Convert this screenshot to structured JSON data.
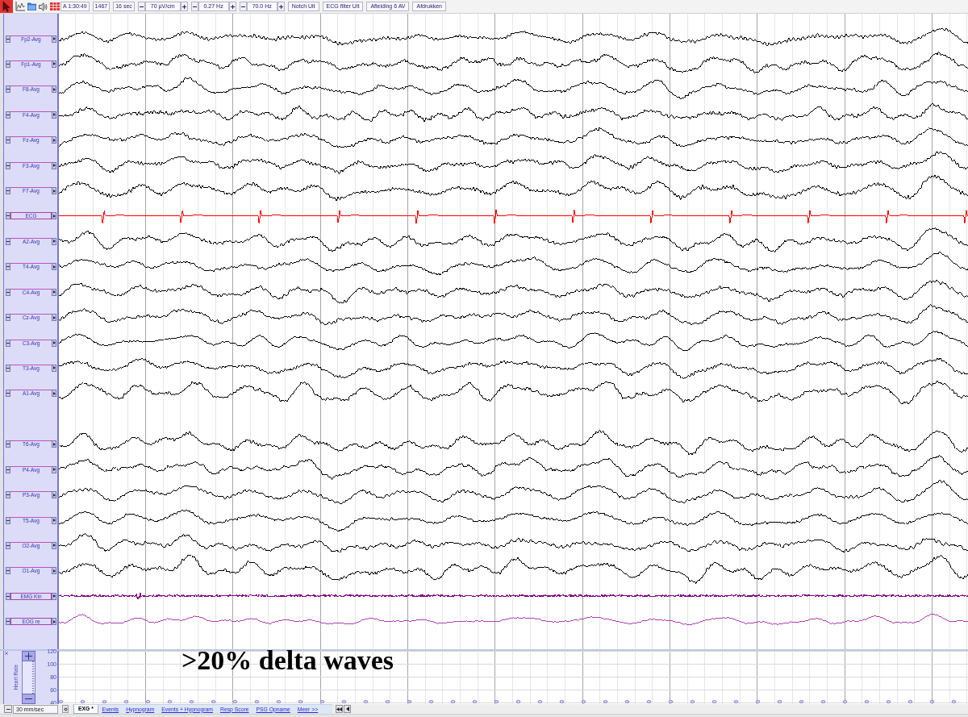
{
  "toolbar": {
    "items": [
      {
        "kind": "field",
        "text": "A 1:30:49"
      },
      {
        "kind": "field",
        "text": "1467"
      },
      {
        "kind": "field",
        "text": "16 sec"
      },
      {
        "kind": "stepper",
        "text": "70 µV/cm"
      },
      {
        "kind": "stepper",
        "text": "0.27 Hz"
      },
      {
        "kind": "stepper",
        "text": "70.0 Hz"
      },
      {
        "kind": "button",
        "text": "Notch Uit"
      },
      {
        "kind": "button",
        "text": "ECG filter Uit"
      },
      {
        "kind": "button",
        "text": "Afleiding 6 AV"
      },
      {
        "kind": "button",
        "text": "Afdrukken"
      }
    ]
  },
  "channel_groups": [
    {
      "channels": [
        {
          "label": "Fp2-Avg",
          "kind": "eeg",
          "color": "#000000"
        },
        {
          "label": "Fp1-Avg",
          "kind": "eeg",
          "color": "#000000"
        },
        {
          "label": "F8-Avg",
          "kind": "eeg",
          "color": "#000000"
        },
        {
          "label": "F4-Avg",
          "kind": "eeg",
          "color": "#000000"
        },
        {
          "label": "Fz-Avg",
          "kind": "eeg",
          "color": "#000000"
        },
        {
          "label": "F3-Avg",
          "kind": "eeg",
          "color": "#000000"
        },
        {
          "label": "F7-Avg",
          "kind": "eeg",
          "color": "#000000"
        },
        {
          "label": "ECG",
          "kind": "ecg",
          "color": "#ff0000"
        },
        {
          "label": "A2-Avg",
          "kind": "eeg",
          "color": "#000000"
        },
        {
          "label": "T4-Avg",
          "kind": "eeg",
          "color": "#000000"
        },
        {
          "label": "C4-Avg",
          "kind": "eeg",
          "color": "#000000"
        },
        {
          "label": "Cz-Avg",
          "kind": "eeg",
          "color": "#000000"
        },
        {
          "label": "C3-Avg",
          "kind": "eeg",
          "color": "#000000"
        },
        {
          "label": "T3-Avg",
          "kind": "eeg",
          "color": "#000000"
        },
        {
          "label": "A1-Avg",
          "kind": "eeg",
          "color": "#000000"
        }
      ]
    },
    {
      "channels": [
        {
          "label": "T6-Avg",
          "kind": "eeg",
          "color": "#000000"
        },
        {
          "label": "P4-Avg",
          "kind": "eeg",
          "color": "#000000"
        },
        {
          "label": "P3-Avg",
          "kind": "eeg",
          "color": "#000000"
        },
        {
          "label": "T5-Avg",
          "kind": "eeg",
          "color": "#000000"
        },
        {
          "label": "O2-Avg",
          "kind": "eeg",
          "color": "#000000"
        },
        {
          "label": "O1-Avg",
          "kind": "eeg",
          "color": "#000000"
        },
        {
          "label": "EMG Kin",
          "kind": "emg",
          "color": "#800080"
        },
        {
          "label": "EOG re",
          "kind": "eog",
          "color": "#b03cb0"
        }
      ]
    }
  ],
  "heart_rate_panel": {
    "title": "Heart Rate",
    "yticks": [
      "120",
      "100",
      "80",
      "60",
      "40"
    ]
  },
  "annotation": ">20% delta waves",
  "bottom_bar": {
    "speed": "30 mm/sec",
    "tabs": [
      {
        "label": "EXG *",
        "selected": true
      },
      {
        "label": "Events",
        "selected": false
      },
      {
        "label": "Hypnogram",
        "selected": false
      },
      {
        "label": "Events + Hypnogram",
        "selected": false
      },
      {
        "label": "Resp Score",
        "selected": false
      },
      {
        "label": "PSG Opname",
        "selected": false
      },
      {
        "label": "Meer >>",
        "selected": false
      }
    ]
  }
}
